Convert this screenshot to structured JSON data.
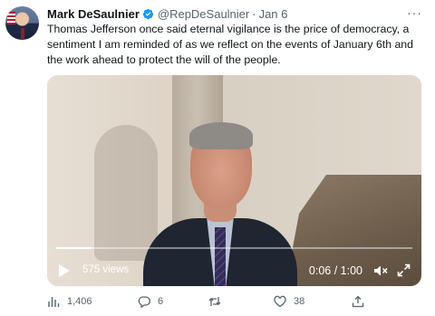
{
  "tweet": {
    "author_name": "Mark DeSaulnier",
    "handle": "@RepDeSaulnier",
    "separator": "·",
    "date": "Jan 6",
    "more_label": "···",
    "text": "Thomas Jefferson once said eternal vigilance is the price of democracy, a sentiment I am reminded of as we reflect on the events of January 6th and the work ahead to protect the will of the people."
  },
  "video": {
    "views": "575 views",
    "time": "0:06 / 1:00",
    "progress": 0.1
  },
  "actions": {
    "analytics": "1,406",
    "replies": "6",
    "retweets": "",
    "likes": "38"
  },
  "colors": {
    "verified": "#1d9bf0",
    "muted_text": "#536471",
    "primary_text": "#0f1419"
  },
  "icons": [
    "verified-badge-icon",
    "more-icon",
    "play-icon",
    "volume-muted-icon",
    "fullscreen-icon",
    "analytics-icon",
    "reply-icon",
    "retweet-icon",
    "like-icon",
    "share-icon"
  ]
}
